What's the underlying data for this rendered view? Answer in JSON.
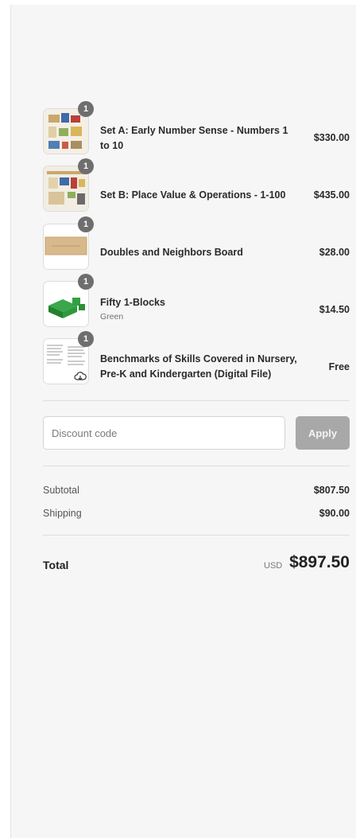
{
  "items": [
    {
      "title": "Set A: Early Number Sense - Numbers 1 to 10",
      "price": "$330.00",
      "quantity": "1",
      "variant": ""
    },
    {
      "title": "Set B: Place Value & Operations - 1-100",
      "price": "$435.00",
      "quantity": "1",
      "variant": ""
    },
    {
      "title": "Doubles and Neighbors Board",
      "price": "$28.00",
      "quantity": "1",
      "variant": ""
    },
    {
      "title": "Fifty 1-Blocks",
      "price": "$14.50",
      "quantity": "1",
      "variant": "Green"
    },
    {
      "title": "Benchmarks of Skills Covered in Nursery, Pre-K and Kindergarten (Digital File)",
      "price": "Free",
      "quantity": "1",
      "variant": ""
    }
  ],
  "discount": {
    "placeholder": "Discount code",
    "apply_label": "Apply"
  },
  "summary": {
    "subtotal_label": "Subtotal",
    "subtotal_value": "$807.50",
    "shipping_label": "Shipping",
    "shipping_value": "$90.00",
    "total_label": "Total",
    "currency": "USD",
    "total_value": "$897.50"
  },
  "colors": {
    "panel_bg": "#f6f6f6",
    "badge": "#6e6e6e",
    "apply_disabled": "#a8a8a8"
  }
}
